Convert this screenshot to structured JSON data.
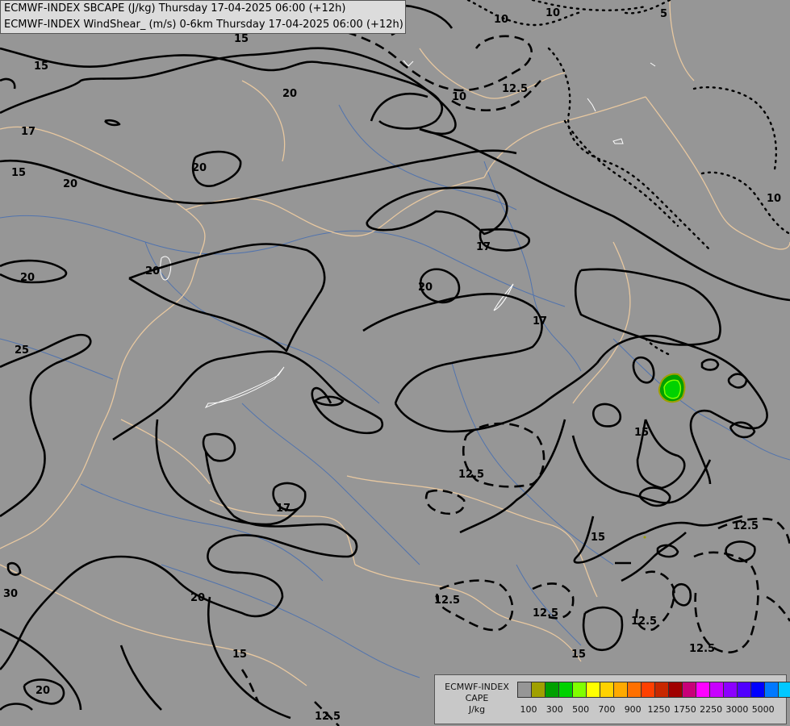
{
  "header": {
    "line1": "ECMWF-INDEX SBCAPE (J/kg) Thursday 17-04-2025 06:00 (+12h)",
    "line2": "ECMWF-INDEX WindShear_ (m/s) 0-6km Thursday 17-04-2025 06:00 (+12h)"
  },
  "contour_labels": {
    "l15a": "15",
    "l17a": "17",
    "l15b": "15",
    "l20a": "20",
    "l20b": "20",
    "l20c": "20",
    "l20d": "20",
    "l20e": "20",
    "l25": "25",
    "l17b": "17",
    "l20f": "20",
    "l17c": "17",
    "l17d": "17",
    "l15c": "15",
    "l15d": "15",
    "l30": "30",
    "l20g": "20",
    "l15e": "15",
    "l20h": "20",
    "l15f": "15",
    "l15g": "15",
    "d10a": "10",
    "d10b": "10",
    "d5": "5",
    "d12a": "12.5",
    "d10c": "10",
    "d10d": "10",
    "d12b": "12.5",
    "d12c": "12.5",
    "d12d": "12.5",
    "d12e": "12.5",
    "d12f": "12.5",
    "d12g": "12.5",
    "d12h": "12.5"
  },
  "legend": {
    "title_line1": "ECMWF-INDEX",
    "title_line2": "CAPE",
    "unit": "J/kg",
    "colors": [
      "#969696",
      "#a0a000",
      "#00a000",
      "#00d200",
      "#80ff00",
      "#ffff00",
      "#ffd200",
      "#ffaa00",
      "#ff7000",
      "#ff4000",
      "#c82800",
      "#a00000",
      "#c80078",
      "#ff00ff",
      "#c800ff",
      "#8c00ff",
      "#5000ff",
      "#0000ff",
      "#0078ff",
      "#00c8ff",
      "#00ffff",
      "#ffffff"
    ],
    "ticks": [
      "100",
      "300",
      "500",
      "700",
      "900",
      "1250",
      "1750",
      "2250",
      "3000",
      "5000"
    ]
  }
}
